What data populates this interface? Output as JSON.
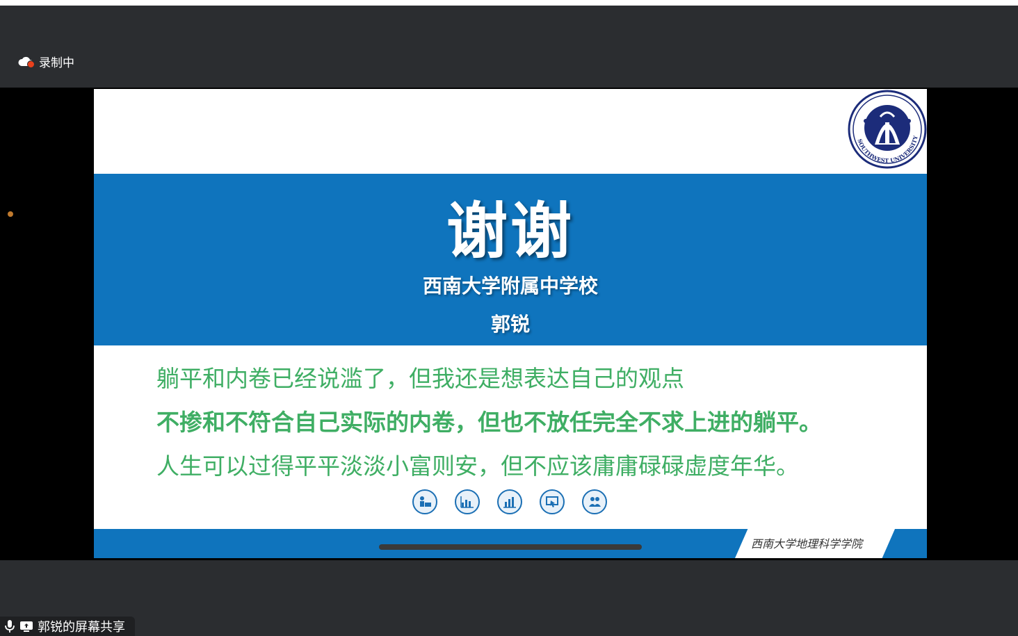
{
  "recording": {
    "label": "录制中",
    "icon": "cloud-recording-icon"
  },
  "slide": {
    "title": "谢谢",
    "school": "西南大学附属中学校",
    "author": "郭锐",
    "body_lines": [
      "躺平和内卷已经说滥了，但我还是想表达自己的观点",
      "不掺和不符合自己实际的内卷，但也不放任完全不求上进的躺平。",
      "人生可以过得平平淡淡小富则安，但不应该庸庸碌碌虚度年华。"
    ],
    "footer": "西南大学地理科学学院",
    "logo_text": "SOUTHWEST UNIVERSITY",
    "accent": "#0f74bd",
    "text_color": "#3fae64",
    "icons": [
      "presenter-icon",
      "bar-chart-icon",
      "growth-chart-icon",
      "screen-pointer-icon",
      "team-icon"
    ]
  },
  "share": {
    "label": "郭锐的屏幕共享"
  }
}
